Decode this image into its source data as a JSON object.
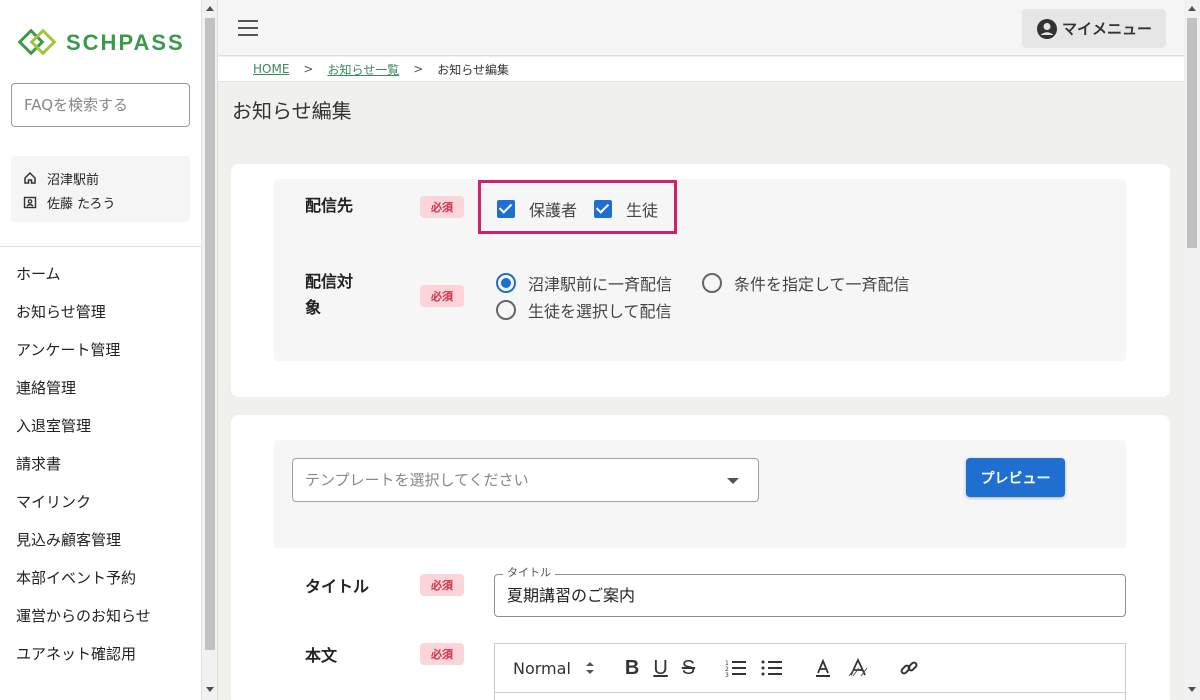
{
  "brand": {
    "name": "SCHPASS"
  },
  "sidebar": {
    "search_placeholder": "FAQを検索する",
    "school": "沼津駅前",
    "user": "佐藤 たろう",
    "items": [
      {
        "label": "ホーム"
      },
      {
        "label": "お知らせ管理"
      },
      {
        "label": "アンケート管理"
      },
      {
        "label": "連絡管理"
      },
      {
        "label": "入退室管理"
      },
      {
        "label": "請求書"
      },
      {
        "label": "マイリンク"
      },
      {
        "label": "見込み顧客管理"
      },
      {
        "label": "本部イベント予約"
      },
      {
        "label": "運営からのお知らせ"
      },
      {
        "label": "ユアネット確認用"
      }
    ]
  },
  "header": {
    "mymenu_label": "マイメニュー"
  },
  "breadcrumb": {
    "home": "HOME",
    "sep": ">",
    "list": "お知らせ一覧",
    "current": "お知らせ編集"
  },
  "page": {
    "title": "お知らせ編集"
  },
  "form": {
    "required_label": "必須",
    "destination": {
      "label": "配信先",
      "options": [
        {
          "label": "保護者",
          "checked": true
        },
        {
          "label": "生徒",
          "checked": true
        }
      ]
    },
    "target": {
      "label_line1": "配信対",
      "label_line2": "象",
      "options": [
        {
          "label": "沼津駅前に一斉配信",
          "selected": true
        },
        {
          "label": "条件を指定して一斉配信",
          "selected": false
        },
        {
          "label": "生徒を選択して配信",
          "selected": false
        }
      ]
    },
    "template": {
      "placeholder": "テンプレートを選択してください"
    },
    "preview_label": "プレビュー",
    "title_field": {
      "label": "タイトル",
      "legend": "タイトル",
      "value": "夏期講習のご案内"
    },
    "body_field": {
      "label": "本文"
    },
    "editor": {
      "format": "Normal",
      "bold": "B",
      "underline": "U",
      "strike": "S"
    }
  },
  "colors": {
    "accent": "#1e6fd0",
    "brand": "#3a9a4a",
    "highlight": "#d0216f",
    "required_bg": "#fbd5d9",
    "required_text": "#d0344a"
  }
}
